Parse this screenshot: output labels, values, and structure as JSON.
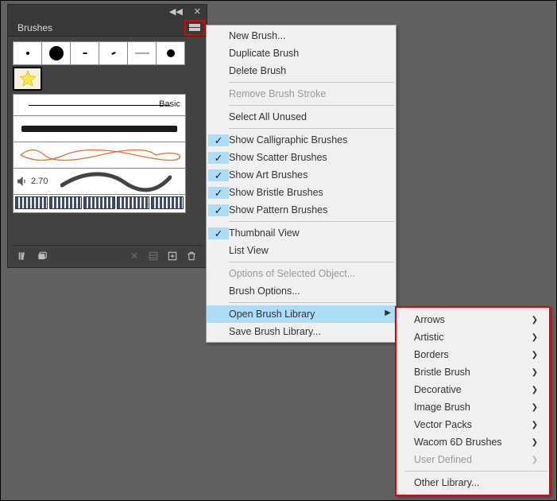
{
  "panel": {
    "title": "Brushes",
    "basic_label": "Basic",
    "audio_value": "2.70"
  },
  "menu": {
    "new_brush": "New Brush...",
    "duplicate_brush": "Duplicate Brush",
    "delete_brush": "Delete Brush",
    "remove_stroke": "Remove Brush Stroke",
    "select_unused": "Select All Unused",
    "show_calligraphic": "Show Calligraphic Brushes",
    "show_scatter": "Show Scatter Brushes",
    "show_art": "Show Art Brushes",
    "show_bristle": "Show Bristle Brushes",
    "show_pattern": "Show Pattern Brushes",
    "thumbnail_view": "Thumbnail View",
    "list_view": "List View",
    "options_selected": "Options of Selected Object...",
    "brush_options": "Brush Options...",
    "open_library": "Open Brush Library",
    "save_library": "Save Brush Library..."
  },
  "submenu": {
    "arrows": "Arrows",
    "artistic": "Artistic",
    "borders": "Borders",
    "bristle": "Bristle Brush",
    "decorative": "Decorative",
    "image_brush": "Image Brush",
    "vector_packs": "Vector Packs",
    "wacom": "Wacom 6D Brushes",
    "user_defined": "User Defined",
    "other": "Other Library..."
  }
}
